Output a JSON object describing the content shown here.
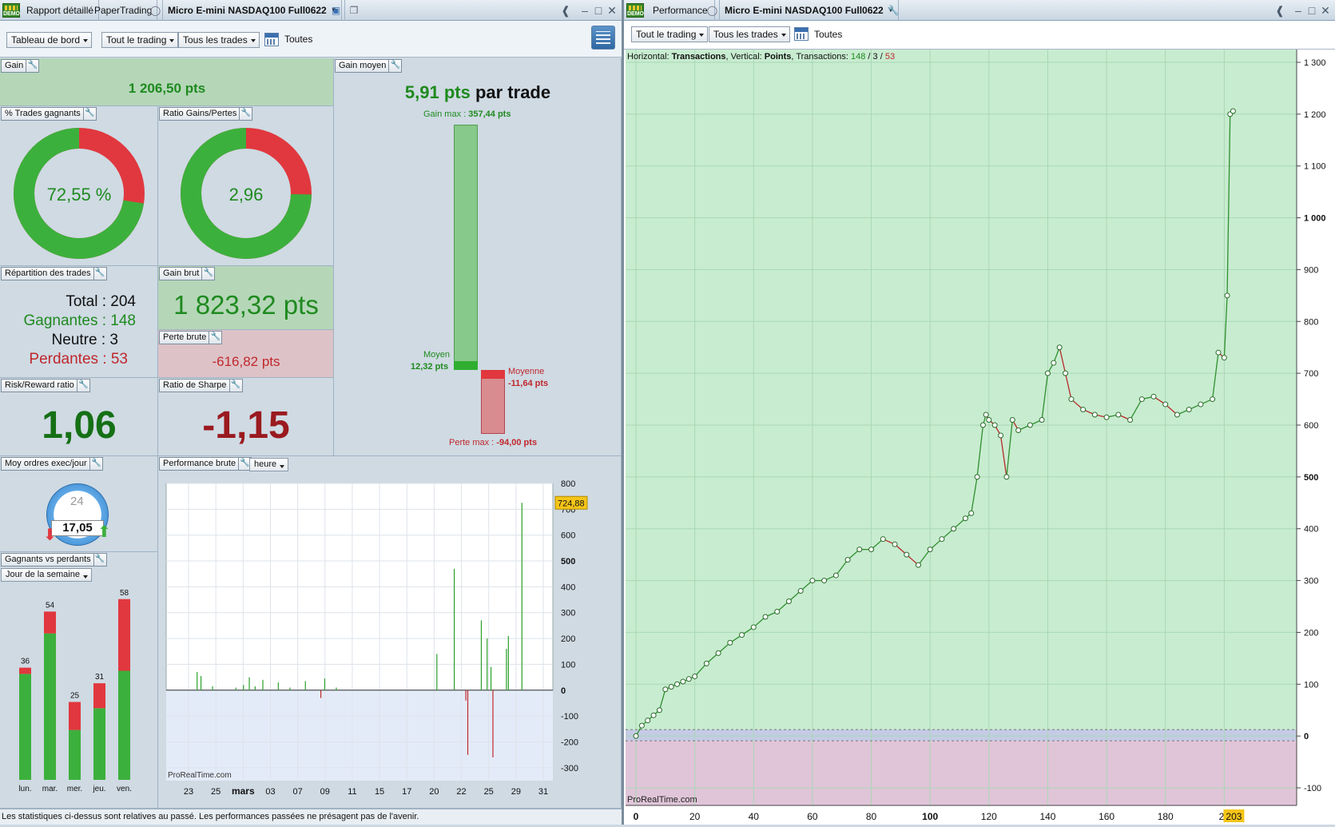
{
  "left_window": {
    "tabs": [
      "Rapport détaillé",
      "PaperTrading"
    ],
    "instrument": "Micro E-mini NASDAQ100 Full0622",
    "demo_badge": "DEMO",
    "toolbar": {
      "view": "Tableau de bord",
      "trading": "Tout le trading",
      "trades": "Tous les trades",
      "period": "Toutes"
    }
  },
  "right_window": {
    "tab": "Performance",
    "instrument": "Micro E-mini NASDAQ100 Full0622",
    "toolbar": {
      "trading": "Tout le trading",
      "trades": "Tous les trades",
      "period": "Toutes"
    }
  },
  "panels": {
    "gain": {
      "label": "Gain",
      "value": "1 206,50 pts"
    },
    "pct_winning": {
      "label": "% Trades gagnants",
      "value": "72,55 %",
      "win_fraction": 0.7255
    },
    "ratio_gp": {
      "label": "Ratio Gains/Pertes",
      "value": "2,96",
      "win_fraction": 0.7473
    },
    "avg_gain": {
      "label": "Gain moyen",
      "value": "5,91 pts",
      "suffix": "par trade",
      "max_label": "Gain max :",
      "max_value": "357,44 pts",
      "avg_label": "Moyen",
      "avg_value": "12,32 pts",
      "avg_loss_label": "Moyenne",
      "avg_loss_value": "-11,64 pts",
      "max_loss_label": "Perte max :",
      "max_loss_value": "-94,00 pts"
    },
    "distribution": {
      "label": "Répartition des trades",
      "total_label": "Total :",
      "total": "204",
      "win_label": "Gagnantes :",
      "win": "148",
      "neutral_label": "Neutre :",
      "neutral": "3",
      "loss_label": "Perdantes :",
      "loss": "53"
    },
    "gross_gain": {
      "label": "Gain brut",
      "value": "1 823,32 pts"
    },
    "gross_loss": {
      "label": "Perte brute",
      "value": "-616,82 pts"
    },
    "risk_reward": {
      "label": "Risk/Reward ratio",
      "value": "1,06"
    },
    "sharpe": {
      "label": "Ratio de Sharpe",
      "value": "-1,15"
    },
    "orders_day": {
      "label": "Moy ordres exec/jour",
      "value": "17,05",
      "clock": "24"
    },
    "raw_perf": {
      "label": "Performance brute",
      "unit": "heure",
      "watermark": "ProRealTime.com"
    },
    "win_vs_loss": {
      "label": "Gagnants vs perdants",
      "mode": "Jour de la semaine"
    }
  },
  "footer": "Les statistiques ci-dessus sont relatives au passé. Les performances passées ne présagent pas de l'avenir.",
  "chart_data": [
    {
      "type": "bar",
      "title": "Gagnants vs perdants",
      "categories": [
        "lun.",
        "mar.",
        "mer.",
        "jeu.",
        "ven."
      ],
      "series": [
        {
          "name": "",
          "values": [
            34,
            47,
            16,
            23,
            35
          ]
        },
        {
          "name": "",
          "values": [
            2,
            7,
            9,
            8,
            23
          ]
        }
      ],
      "totals": [
        "36",
        "54",
        "25",
        "31",
        "58"
      ],
      "colors": [
        "#3cb03c",
        "#e0383e"
      ]
    },
    {
      "type": "bar",
      "title": "Performance brute",
      "xlabel": "",
      "ylabel": "",
      "ylim": [
        -350,
        800
      ],
      "yticks": [
        "800",
        "700",
        "600",
        "500",
        "400",
        "300",
        "200",
        "100",
        "0",
        "-100",
        "-200",
        "-300"
      ],
      "ytick_values": [
        800,
        700,
        600,
        500,
        400,
        300,
        200,
        100,
        0,
        -100,
        -200,
        -300
      ],
      "xticks": [
        "23",
        "25",
        "mars",
        "03",
        "07",
        "09",
        "11",
        "15",
        "17",
        "20",
        "22",
        "25",
        "29",
        "31"
      ],
      "last_value": "724,88",
      "bars": [
        {
          "x": 0.08,
          "v": 70
        },
        {
          "x": 0.09,
          "v": 55
        },
        {
          "x": 0.12,
          "v": 15
        },
        {
          "x": 0.18,
          "v": 10
        },
        {
          "x": 0.2,
          "v": 20
        },
        {
          "x": 0.215,
          "v": 50
        },
        {
          "x": 0.23,
          "v": 15
        },
        {
          "x": 0.25,
          "v": 40
        },
        {
          "x": 0.29,
          "v": 30
        },
        {
          "x": 0.32,
          "v": 10
        },
        {
          "x": 0.36,
          "v": 35
        },
        {
          "x": 0.4,
          "v": -30
        },
        {
          "x": 0.41,
          "v": 45
        },
        {
          "x": 0.44,
          "v": 10
        },
        {
          "x": 0.7,
          "v": 140
        },
        {
          "x": 0.745,
          "v": 470
        },
        {
          "x": 0.775,
          "v": -40
        },
        {
          "x": 0.78,
          "v": -250
        },
        {
          "x": 0.815,
          "v": 270
        },
        {
          "x": 0.83,
          "v": 200
        },
        {
          "x": 0.84,
          "v": 90
        },
        {
          "x": 0.845,
          "v": -260
        },
        {
          "x": 0.88,
          "v": 160
        },
        {
          "x": 0.885,
          "v": 210
        },
        {
          "x": 0.92,
          "v": 725
        }
      ],
      "watermark": "ProRealTime.com",
      "colors": [
        "#2aa02a",
        "#c0272d"
      ]
    },
    {
      "type": "line",
      "title": "Performance",
      "subtitle_parts": {
        "h_label": "Horizontal:",
        "h_value": "Transactions",
        "v_label": "Vertical:",
        "v_value": "Points",
        "t_label": "Transactions:",
        "wins": "148",
        "neutral": "3",
        "losses": "53"
      },
      "xlabel": "Transactions",
      "ylabel": "Points",
      "xlim": [
        0,
        220
      ],
      "ylim": [
        -100,
        1300
      ],
      "xticks": [
        "0",
        "20",
        "40",
        "60",
        "80",
        "100",
        "120",
        "140",
        "160",
        "180",
        "20"
      ],
      "xtick_values": [
        0,
        20,
        40,
        60,
        80,
        100,
        120,
        140,
        160,
        180,
        200
      ],
      "yticks": [
        "1 300",
        "1 200",
        "1 100",
        "1 000",
        "900",
        "800",
        "700",
        "600",
        "500",
        "400",
        "300",
        "200",
        "100",
        "0",
        "-100"
      ],
      "ytick_values": [
        1300,
        1200,
        1100,
        1000,
        900,
        800,
        700,
        600,
        500,
        400,
        300,
        200,
        100,
        0,
        -100
      ],
      "last_x_label": "203",
      "watermark": "ProRealTime.com",
      "x": [
        0,
        2,
        4,
        6,
        8,
        10,
        12,
        14,
        16,
        18,
        20,
        24,
        28,
        32,
        36,
        40,
        44,
        48,
        52,
        56,
        60,
        64,
        68,
        72,
        76,
        80,
        84,
        88,
        92,
        96,
        100,
        104,
        108,
        112,
        114,
        116,
        118,
        119,
        120,
        122,
        124,
        126,
        128,
        130,
        134,
        138,
        140,
        142,
        144,
        146,
        148,
        152,
        156,
        160,
        164,
        168,
        172,
        176,
        180,
        184,
        188,
        192,
        196,
        198,
        200,
        201,
        202,
        203
      ],
      "y": [
        0,
        20,
        30,
        40,
        50,
        90,
        95,
        100,
        105,
        110,
        115,
        140,
        160,
        180,
        195,
        210,
        230,
        240,
        260,
        280,
        300,
        300,
        310,
        340,
        360,
        360,
        380,
        370,
        350,
        330,
        360,
        380,
        400,
        420,
        430,
        500,
        600,
        620,
        610,
        600,
        580,
        500,
        610,
        590,
        600,
        610,
        700,
        720,
        750,
        700,
        650,
        630,
        620,
        615,
        620,
        610,
        650,
        655,
        640,
        620,
        630,
        640,
        650,
        740,
        730,
        850,
        1200,
        1206
      ]
    }
  ]
}
